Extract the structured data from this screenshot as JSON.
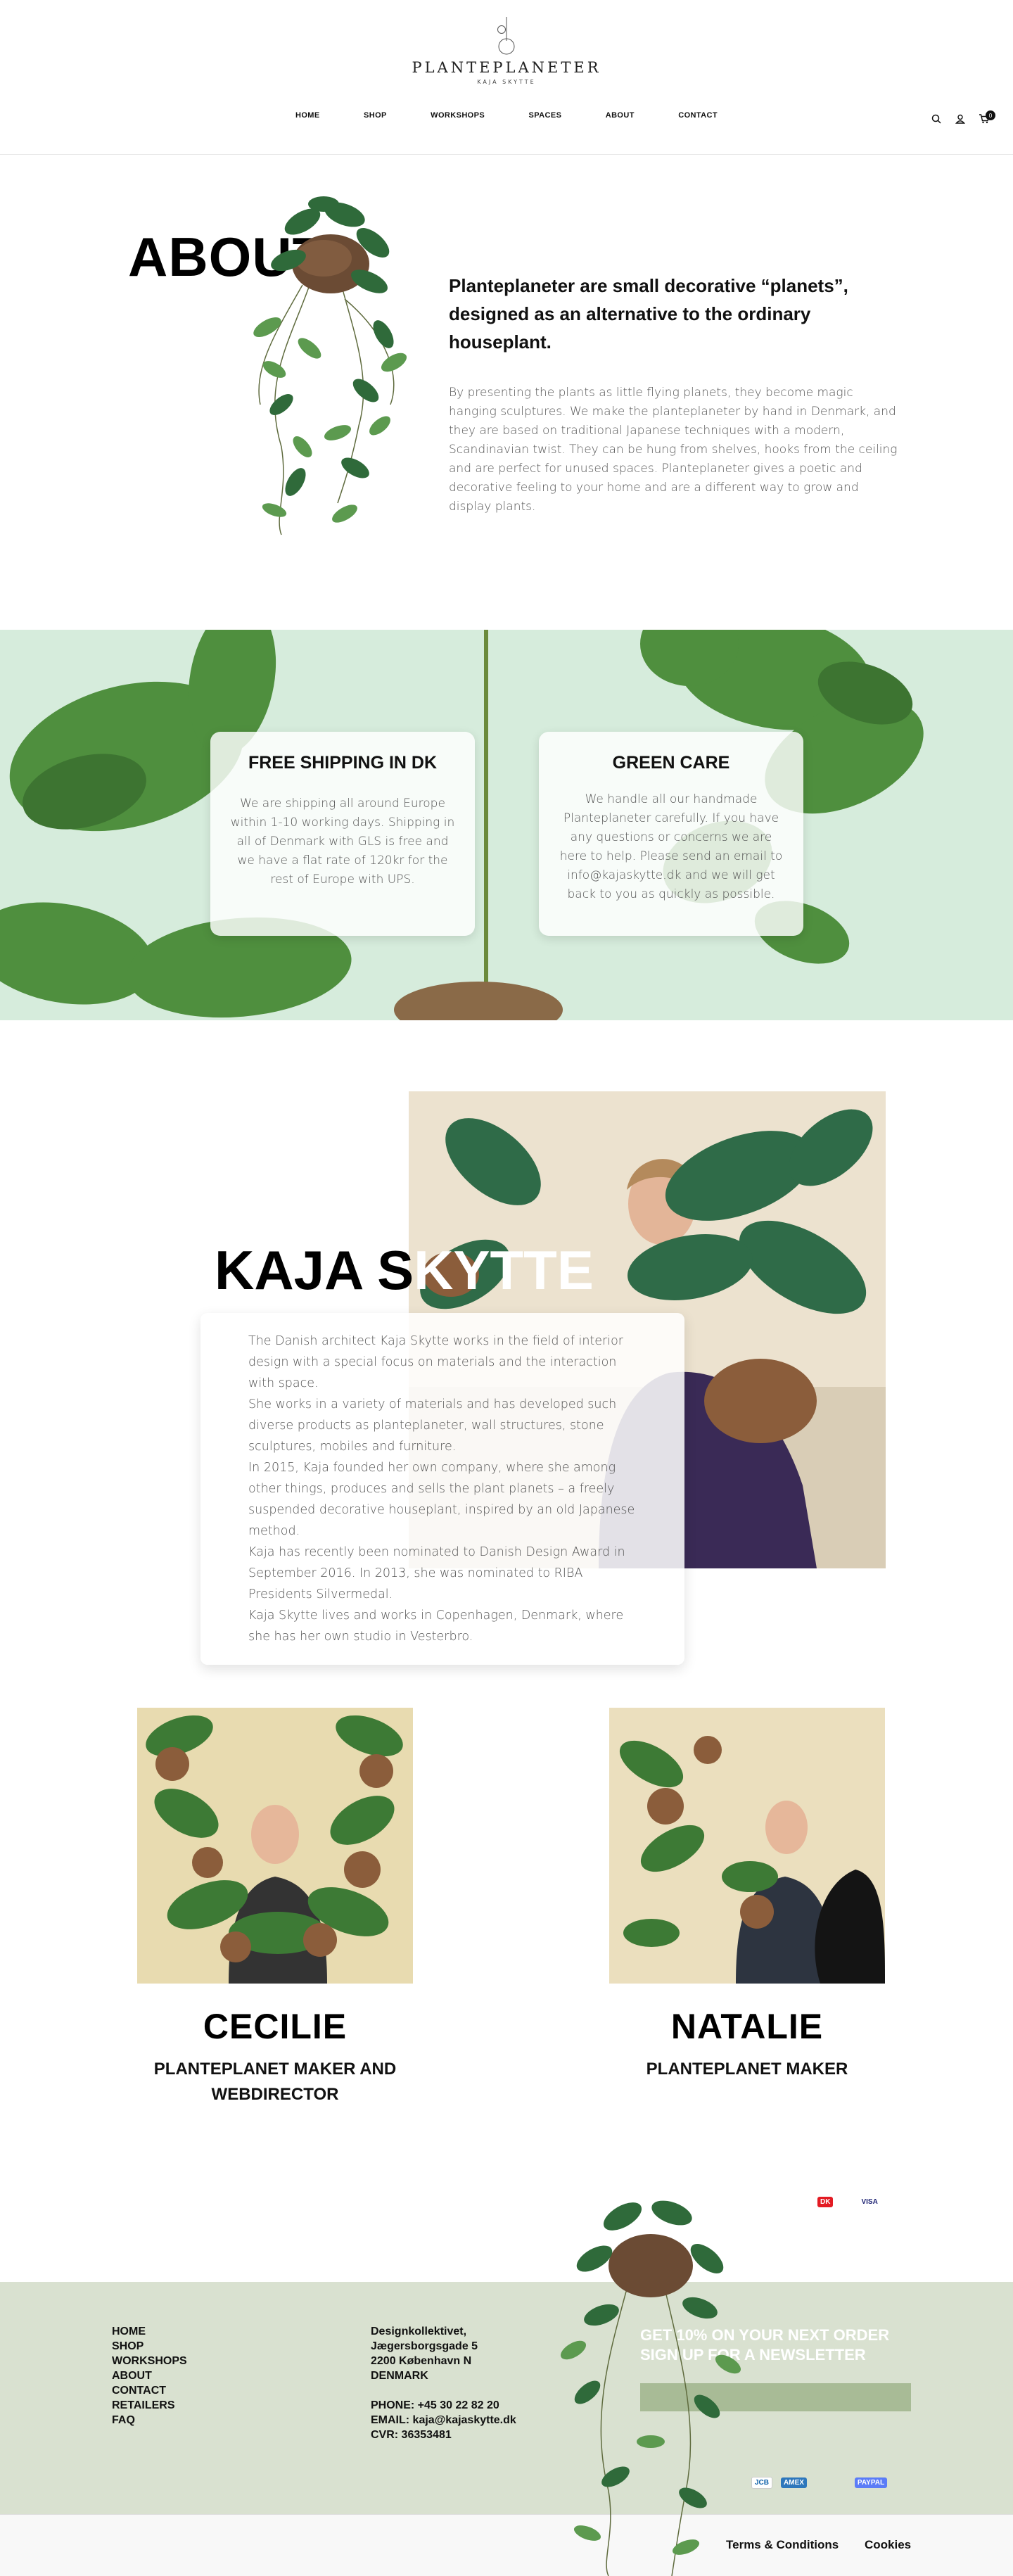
{
  "header": {
    "brand": "PLANTEPLANETER",
    "sub": "KAJA SKYTTE",
    "nav": [
      "HOME",
      "SHOP",
      "WORKSHOPS",
      "SPACES",
      "ABOUT",
      "CONTACT"
    ],
    "cart_count": "0",
    "icons": [
      "search-icon",
      "user-icon",
      "cart-icon"
    ]
  },
  "about": {
    "title": "ABOUT",
    "heading": "Planteplaneter are small decorative “planets”, designed as an alternative to the ordinary houseplant.",
    "body": "By presenting the plants as little flying planets, they become magic hanging sculptures. We make the planteplaneter by hand in Denmark, and they are based on traditional Japanese techniques with a modern, Scandinavian twist.  They can be hung from shelves, hooks from the ceiling and are perfect for unused spaces. Planteplaneter gives a poetic and decorative feeling to your home and are a different way to grow and display plants."
  },
  "cards": [
    {
      "title": "FREE SHIPPING IN DK",
      "body": "We are shipping all around Europe within 1-10 working days. Shipping in all of  Denmark with GLS is free and we have a flat rate of 120kr for the rest of Europe with UPS."
    },
    {
      "title": "GREEN CARE",
      "body": "We handle all our handmade Planteplaneter carefully. If you have any questions or concerns we are here to help. Please send an email to info@kajaskytte.dk and we will get back to you as quickly as possible."
    }
  ],
  "kaja": {
    "title_black": "KAJA S",
    "title_white": "KYTTE",
    "paragraphs": [
      "The Danish architect Kaja Skytte works in the field of interior design with a special focus on materials and the interaction with space.",
      "She works in a variety of materials and has developed such diverse products as planteplaneter, wall structures, stone sculptures, mobiles and furniture.",
      "In 2015, Kaja founded her own company, where she among other things, produces and sells the plant planets – a freely suspended decorative houseplant, inspired by an old Japanese method.",
      "Kaja has recently been nominated to Danish Design Award in September 2016. In 2013, she was nominated to RIBA Presidents Silvermedal.",
      "Kaja Skytte lives and works in Copenhagen, Denmark, where she has her own studio in Vesterbro."
    ]
  },
  "team": [
    {
      "name": "CECILIE",
      "role": "PLANTEPLANET MAKER AND WEBDIRECTOR"
    },
    {
      "name": "NATALIE",
      "role": "PLANTEPLANET MAKER"
    }
  ],
  "payments_top": [
    "DK",
    "VISA"
  ],
  "footer": {
    "nav": [
      "HOME",
      "SHOP",
      "WORKSHOPS",
      "ABOUT",
      "CONTACT",
      "RETAILERS",
      "FAQ"
    ],
    "address": [
      "Designkollektivet,",
      "Jægersborgsgade 5",
      "2200 København N",
      "DENMARK"
    ],
    "contact": [
      "PHONE: +45 30 22 82 20",
      "EMAIL: kaja@kajaskytte.dk",
      "CVR: 36353481"
    ],
    "newsletter_line1": "GET 10% ON YOUR NEXT ORDER",
    "newsletter_line2": "SIGN UP FOR A NEWSLETTER",
    "newsletter_placeholder": "",
    "payments": [
      "JCB",
      "AMEX",
      "PAYPAL"
    ]
  },
  "bottom": {
    "terms": "Terms & Conditions",
    "cookies": "Cookies"
  },
  "colors": {
    "band": "#d6ecdc",
    "footer": "#d9e1d0",
    "newsletter_input": "#a8bb96"
  }
}
